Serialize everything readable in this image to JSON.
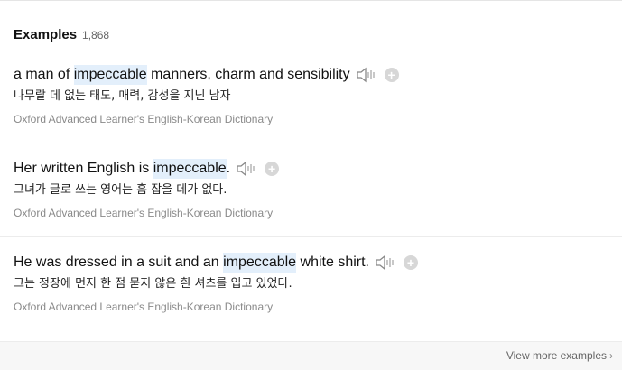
{
  "header": {
    "title": "Examples",
    "count": "1,868"
  },
  "examples": [
    {
      "before": "a man of ",
      "highlight": "impeccable",
      "after": " manners, charm and sensibility",
      "translation": "나무랄 데 없는 태도, 매력, 감성을 지닌 남자",
      "source": "Oxford Advanced Learner's English-Korean Dictionary"
    },
    {
      "before": "Her written English is ",
      "highlight": "impeccable",
      "after": ".",
      "translation": "그녀가 글로 쓰는 영어는 흠 잡을 데가 없다.",
      "source": "Oxford Advanced Learner's English-Korean Dictionary"
    },
    {
      "before": "He was dressed in a suit and an ",
      "highlight": "impeccable",
      "after": " white shirt.",
      "translation": "그는 정장에 먼지 한 점 묻지 않은 흰 셔츠를 입고 있었다.",
      "source": "Oxford Advanced Learner's English-Korean Dictionary"
    }
  ],
  "icons": {
    "audio": "speaker-icon",
    "add": "plus-circle-icon",
    "more": "chevron-right-icon"
  },
  "add_symbol": "+",
  "footer": {
    "view_more": "View more examples",
    "chevron": "›"
  },
  "colors": {
    "highlight": "#e3effb",
    "source_text": "#8a8a8a",
    "add_button": "#d7d7d7"
  }
}
